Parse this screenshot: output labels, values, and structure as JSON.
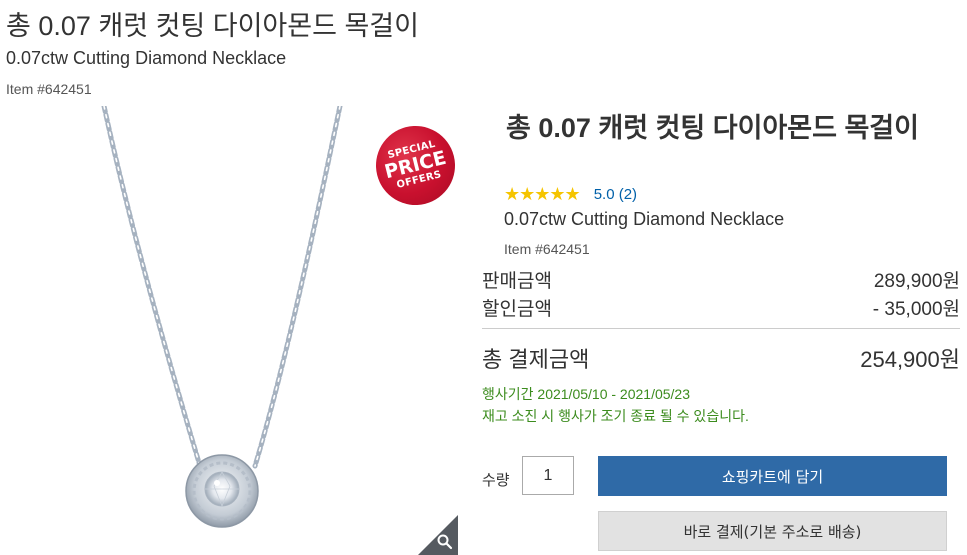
{
  "header": {
    "title": "총 0.07 캐럿 컷팅 다이아몬드 목걸이",
    "subtitle": "0.07ctw Cutting Diamond Necklace",
    "item_number": "Item #642451"
  },
  "gallery": {
    "badge": {
      "line1": "SPECIAL",
      "line2": "PRICE",
      "line3": "OFFERS",
      "color": "#c8102e"
    },
    "zoom_icon": "magnifier-icon"
  },
  "product": {
    "title": "총 0.07 캐럿 컷팅 다이아몬드 목걸이",
    "rating": {
      "stars": "★★★★★",
      "score_text": "5.0 (2)",
      "star_color": "#f5c400"
    },
    "subtitle": "0.07ctw Cutting Diamond Necklace",
    "item_number": "Item #642451"
  },
  "pricing": {
    "sale_label": "판매금액",
    "sale_value": "289,900원",
    "discount_label": "할인금액",
    "discount_value": "- 35,000원",
    "total_label": "총 결제금액",
    "total_value": "254,900원"
  },
  "promotion": {
    "period": "행사기간 2021/05/10 - 2021/05/23",
    "notice": "재고 소진 시 행사가 조기 종료 될 수 있습니다.",
    "color": "#3c8c1e"
  },
  "purchase": {
    "qty_label": "수량",
    "qty_value": "1",
    "add_to_cart": "쇼핑카트에 담기",
    "buy_now": "바로 결제(기본 주소로 배송)",
    "cart_color": "#2f6aa7"
  }
}
